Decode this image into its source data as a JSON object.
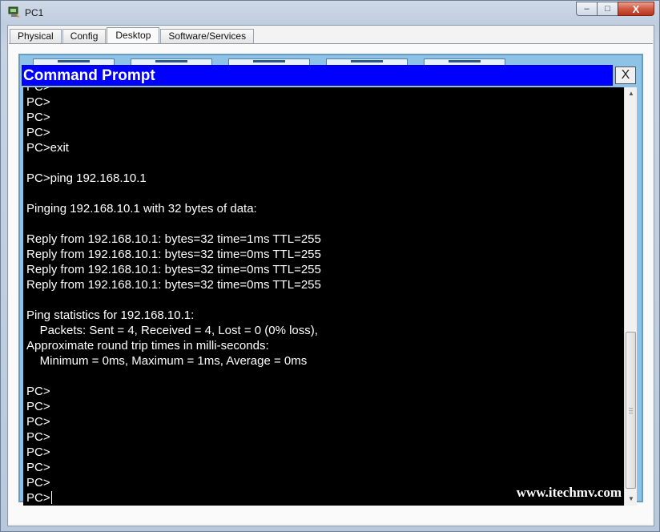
{
  "window": {
    "title": "PC1",
    "controls": {
      "minimize": "–",
      "maximize": "□",
      "close": "X"
    }
  },
  "tabs": [
    {
      "label": "Physical",
      "active": false
    },
    {
      "label": "Config",
      "active": false
    },
    {
      "label": "Desktop",
      "active": true
    },
    {
      "label": "Software/Services",
      "active": false
    }
  ],
  "command_prompt": {
    "title": "Command Prompt",
    "close_label": "X",
    "lines": [
      "PC>",
      "PC>",
      "PC>",
      "PC>",
      "PC>exit",
      "",
      "PC>ping 192.168.10.1",
      "",
      "Pinging 192.168.10.1 with 32 bytes of data:",
      "",
      "Reply from 192.168.10.1: bytes=32 time=1ms TTL=255",
      "Reply from 192.168.10.1: bytes=32 time=0ms TTL=255",
      "Reply from 192.168.10.1: bytes=32 time=0ms TTL=255",
      "Reply from 192.168.10.1: bytes=32 time=0ms TTL=255",
      "",
      "Ping statistics for 192.168.10.1:",
      "    Packets: Sent = 4, Received = 4, Lost = 0 (0% loss),",
      "Approximate round trip times in milli-seconds:",
      "    Minimum = 0ms, Maximum = 1ms, Average = 0ms",
      "",
      "PC>",
      "PC>",
      "PC>",
      "PC>",
      "PC>",
      "PC>",
      "PC>",
      "PC>"
    ],
    "watermark": "www.itechmv.com"
  },
  "colors": {
    "cmd_titlebar": "#0000ff",
    "console_bg": "#000000",
    "console_text": "#ffffff",
    "desktop_bg": "#8ec3e8"
  }
}
